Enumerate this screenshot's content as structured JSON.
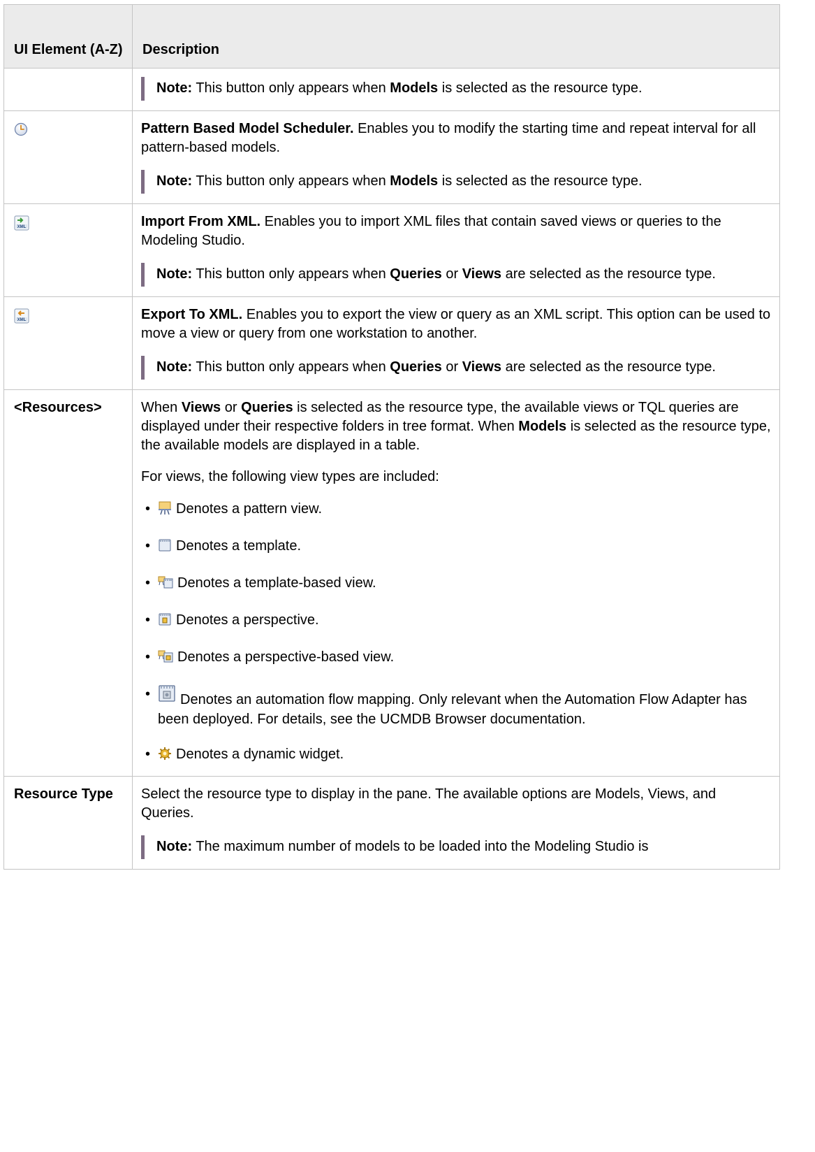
{
  "header": {
    "col1": "UI Element (A-Z)",
    "col2": "Description"
  },
  "row_continued": {
    "note_label": "Note:",
    "note_pre": "This button only appears when",
    "note_bold": "Models",
    "note_post": "is selected as the resource type."
  },
  "row_scheduler": {
    "icon": "clock-icon",
    "title": "Pattern Based Model Scheduler.",
    "text": "Enables you to modify the starting time and repeat interval for all pattern-based models.",
    "note_label": "Note:",
    "note_pre": "This button only appears when",
    "note_bold": "Models",
    "note_post": "is selected as the resource type."
  },
  "row_import": {
    "icon": "import-xml-icon",
    "title": "Import From XML.",
    "text": "Enables you to import XML files that contain saved views or queries to the Modeling Studio.",
    "note_label": "Note:",
    "note_pre": "This button only appears when",
    "note_bold1": "Queries",
    "note_mid": "or",
    "note_bold2": "Views",
    "note_post": "are selected as the resource type."
  },
  "row_export": {
    "icon": "export-xml-icon",
    "title": "Export To XML.",
    "text": "Enables you to export the view or query as an XML script. This option can be used to move a view or query from one workstation to another.",
    "note_label": "Note:",
    "note_pre": "This button only appears when",
    "note_bold1": "Queries",
    "note_mid": "or",
    "note_bold2": "Views",
    "note_post": "are selected as the resource type."
  },
  "row_resources": {
    "label": "<Resources>",
    "p1_pre": "When",
    "p1_b1": "Views",
    "p1_or": "or",
    "p1_b2": "Queries",
    "p1_mid": "is selected as the resource type, the available views or TQL queries are displayed under their respective folders in tree format. When",
    "p1_b3": "Models",
    "p1_post": "is selected as the resource type, the available models are displayed in a table.",
    "p2": "For views, the following view types are included:",
    "items": [
      {
        "icon": "pattern-view-icon",
        "text": "Denotes a pattern view."
      },
      {
        "icon": "template-icon",
        "text": "Denotes a template."
      },
      {
        "icon": "template-based-view-icon",
        "text": "Denotes a template-based view."
      },
      {
        "icon": "perspective-icon",
        "text": "Denotes a perspective."
      },
      {
        "icon": "perspective-based-view-icon",
        "text": "Denotes a perspective-based view."
      },
      {
        "icon": "automation-flow-mapping-icon",
        "text": "Denotes an automation flow mapping. Only relevant when the Automation Flow Adapter has been deployed. For details, see the UCMDB Browser documentation."
      },
      {
        "icon": "dynamic-widget-icon",
        "text": "Denotes a dynamic widget."
      }
    ]
  },
  "row_resource_type": {
    "label": "Resource Type",
    "text": "Select the resource type to display in the pane. The available options are Models, Views, and Queries.",
    "note_label": "Note:",
    "note_text": "The maximum number of models to be loaded into the Modeling Studio is"
  }
}
